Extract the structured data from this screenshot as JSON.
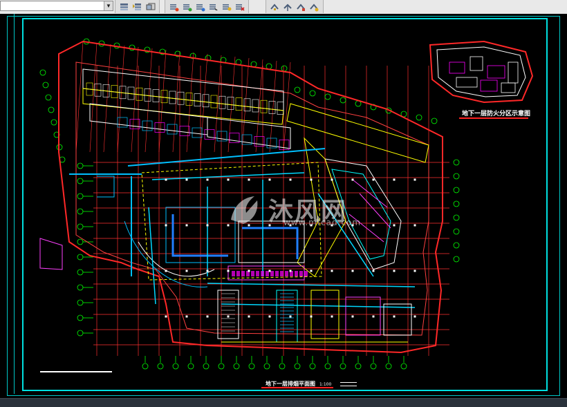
{
  "toolbar": {
    "layer_combo": {
      "value": ""
    },
    "groups": [
      {
        "name": "layer-tools",
        "buttons": [
          "layer-state-icon",
          "layer-match-icon",
          "layer-previous-icon"
        ]
      },
      {
        "name": "modify-tools",
        "buttons": [
          "paint-brush-icon",
          "layer-stack-icon",
          "layer-move-icon",
          "layer-copy-icon",
          "layer-merge-icon",
          "layer-delete-icon"
        ]
      },
      {
        "name": "view-tools",
        "buttons": [
          "tool-1-icon",
          "tool-2-icon",
          "tool-3-icon",
          "tool-4-icon"
        ]
      }
    ]
  },
  "drawing": {
    "key_plan_title": "地下一层防火分区示意图",
    "main_title": "地下一层排烟平面图",
    "main_scale": "1:100",
    "watermark_text": "沐风网",
    "watermark_url": "www.mfcad.com"
  },
  "colors": {
    "background": "#000000",
    "frame": "#00e0e0",
    "walls": "#ffffff",
    "grid": "#ff3030",
    "axis": "#00ff00",
    "ducts": "#ffff00",
    "equipment": "#ff00ff",
    "highlight": "#00c0ff"
  }
}
